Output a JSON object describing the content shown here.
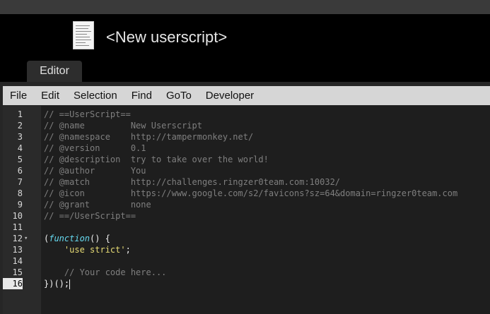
{
  "window": {
    "title": "<New userscript>"
  },
  "tabs": [
    {
      "label": "Editor"
    }
  ],
  "menu": [
    "File",
    "Edit",
    "Selection",
    "Find",
    "GoTo",
    "Developer"
  ],
  "editor": {
    "active_line": 16,
    "lines": [
      {
        "n": "1",
        "text": "// ==UserScript=="
      },
      {
        "n": "2",
        "text": "// @name         New Userscript"
      },
      {
        "n": "3",
        "text": "// @namespace    http://tampermonkey.net/"
      },
      {
        "n": "4",
        "text": "// @version      0.1"
      },
      {
        "n": "5",
        "text": "// @description  try to take over the world!"
      },
      {
        "n": "6",
        "text": "// @author       You"
      },
      {
        "n": "7",
        "text": "// @match        http://challenges.ringzer0team.com:10032/"
      },
      {
        "n": "8",
        "text": "// @icon         https://www.google.com/s2/favicons?sz=64&domain=ringzer0team.com"
      },
      {
        "n": "9",
        "text": "// @grant        none"
      },
      {
        "n": "10",
        "text": "// ==/UserScript=="
      },
      {
        "n": "11",
        "text": ""
      },
      {
        "n": "12",
        "text": "(function() {",
        "kw": "function",
        "pre": "(",
        "post": "() {"
      },
      {
        "n": "13",
        "text": "    'use strict';",
        "str": "'use strict'",
        "indent": "    ",
        "post": ";"
      },
      {
        "n": "14",
        "text": ""
      },
      {
        "n": "15",
        "text": "    // Your code here..."
      },
      {
        "n": "16",
        "text": "})();"
      }
    ]
  }
}
